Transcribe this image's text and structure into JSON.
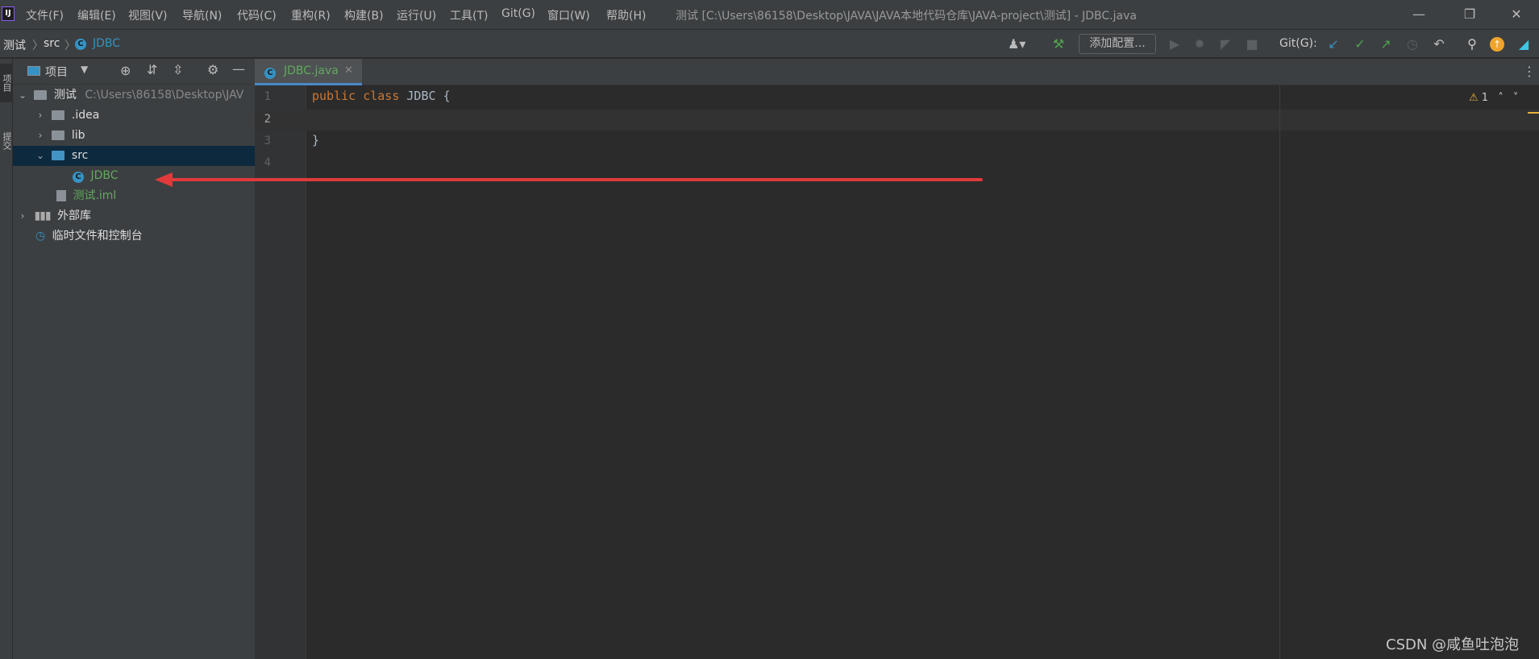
{
  "app": {
    "logo_text": "IJ"
  },
  "menu": [
    {
      "label": "文件(F)"
    },
    {
      "label": "编辑(E)"
    },
    {
      "label": "视图(V)"
    },
    {
      "label": "导航(N)"
    },
    {
      "label": "代码(C)"
    },
    {
      "label": "重构(R)"
    },
    {
      "label": "构建(B)"
    },
    {
      "label": "运行(U)"
    },
    {
      "label": "工具(T)"
    },
    {
      "label": "Git(G)"
    },
    {
      "label": "窗口(W)"
    },
    {
      "label": "帮助(H)"
    }
  ],
  "window_title": "测试 [C:\\Users\\86158\\Desktop\\JAVA\\JAVA本地代码仓库\\JAVA-project\\测试] - JDBC.java",
  "breadcrumb": {
    "project": "测试",
    "folder": "src",
    "file": "JDBC"
  },
  "toolbar": {
    "run_config_label": "添加配置...",
    "git_label": "Git(G):"
  },
  "left_stripe": {
    "project_tab": "项目",
    "commit_tab": "提交"
  },
  "project_panel": {
    "title": "项目"
  },
  "tree": {
    "root_name": "测试",
    "root_path": "C:\\Users\\86158\\Desktop\\JAV",
    "idea": ".idea",
    "lib": "lib",
    "src": "src",
    "jdbc": "JDBC",
    "iml": "测试.iml",
    "external_libs": "外部库",
    "scratches": "临时文件和控制台"
  },
  "editor": {
    "tab_label": "JDBC.java",
    "line_numbers": [
      "1",
      "2",
      "3",
      "4"
    ],
    "code": {
      "keyword1": "public",
      "keyword2": "class",
      "class_name": "JDBC",
      "open_brace": "{",
      "close_brace": "}"
    },
    "warning_count": "1"
  },
  "watermark": "CSDN @咸鱼吐泡泡",
  "colors": {
    "keyword": "#cc7832",
    "class_name": "#a9b7c6",
    "annotation_arrow": "#e03a3a",
    "selection": "#0d293e",
    "tab_underline": "#4a88c7"
  }
}
